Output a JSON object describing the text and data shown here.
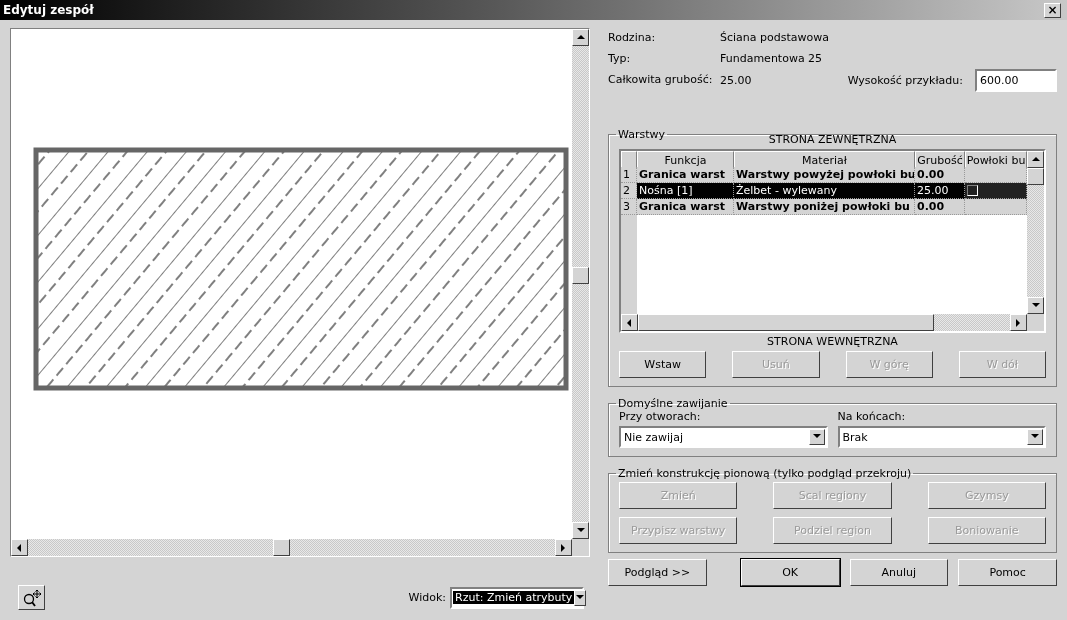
{
  "window": {
    "title": "Edytuj zespół",
    "close": "×"
  },
  "preview": {
    "view_label": "Widok:",
    "view_value": "Rzut: Zmień atrybuty",
    "view_selected": true
  },
  "info": [
    {
      "label": "Rodzina:",
      "value": "Ściana podstawowa"
    },
    {
      "label": "Typ:",
      "value": "Fundamentowa 25"
    },
    {
      "label": "Całkowita grubość:",
      "value": "25.00"
    }
  ],
  "sample_height": {
    "label": "Wysokość przykładu:",
    "value": "600.00"
  },
  "layers": {
    "title": "Warstwy",
    "top_caption": "STRONA ZEWNĘTRZNA",
    "bottom_caption": "STRONA WEWNĘTRZNA",
    "columns": [
      "Funkcja",
      "Materiał",
      "Grubość",
      "Powłoki bu"
    ],
    "rows": [
      {
        "number": "1",
        "kind": "boundary",
        "selected": false,
        "function": "Granica warst",
        "material": "Warstwy powyżej powłoki bu",
        "thickness": "0.00"
      },
      {
        "number": "2",
        "kind": "layer",
        "selected": true,
        "function": "Nośna [1]",
        "material": "Żelbet - wylewany",
        "thickness": "25.00",
        "wraps": false
      },
      {
        "number": "3",
        "kind": "boundary",
        "selected": false,
        "function": "Granica warst",
        "material": "Warstwy poniżej powłoki bu",
        "thickness": "0.00"
      }
    ],
    "buttons": [
      {
        "label": "Wstaw",
        "disabled": false
      },
      {
        "label": "Usuń",
        "disabled": true
      },
      {
        "label": "W górę",
        "disabled": true
      },
      {
        "label": "W dół",
        "disabled": true
      }
    ]
  },
  "wrapping": {
    "title": "Domyślne zawijanie",
    "fields": [
      {
        "label": "Przy otworach:",
        "value": "Nie zawijaj"
      },
      {
        "label": "Na końcach:",
        "value": "Brak"
      }
    ]
  },
  "vertical": {
    "title": "Zmień konstrukcję pionową (tylko podgląd przekroju)",
    "buttons": [
      {
        "label": "Zmień",
        "disabled": true
      },
      {
        "label": "Scal regiony",
        "disabled": true
      },
      {
        "label": "Gzymsy",
        "disabled": true
      },
      {
        "label": "Przypisz warstwy",
        "disabled": true
      },
      {
        "label": "Podziel region",
        "disabled": true
      },
      {
        "label": "Boniowanie",
        "disabled": true
      }
    ]
  },
  "footer": [
    {
      "label": "Podgląd >>",
      "default": false
    },
    {
      "label": "OK",
      "default": true
    },
    {
      "label": "Anuluj",
      "default": false
    },
    {
      "label": "Pomoc",
      "default": false
    }
  ]
}
